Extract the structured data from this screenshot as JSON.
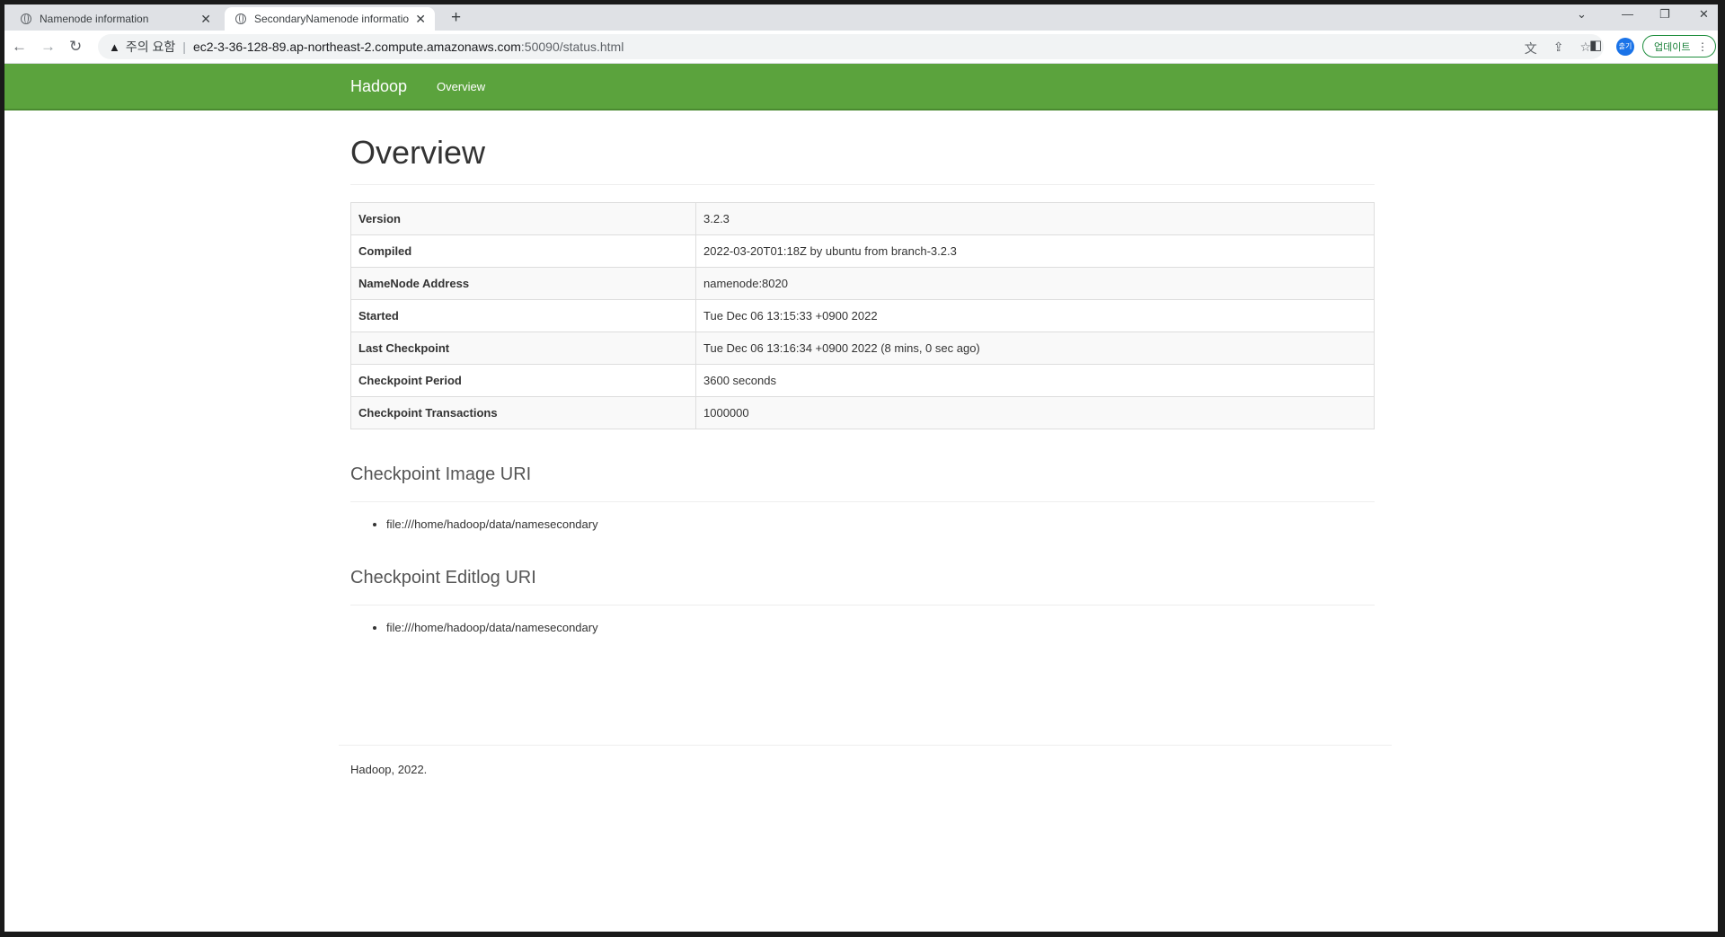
{
  "browser": {
    "tabs": [
      {
        "title": "Namenode information",
        "active": false
      },
      {
        "title": "SecondaryNamenode informatio",
        "active": true
      }
    ],
    "security_warning": "주의 요함",
    "url_host": "ec2-3-36-128-89.ap-northeast-2.compute.amazonaws.com",
    "url_path": ":50090/status.html",
    "profile_label": "출기",
    "update_label": "업데이트"
  },
  "navbar": {
    "brand": "Hadoop",
    "link": "Overview"
  },
  "page": {
    "title": "Overview",
    "info": [
      {
        "key": "Version",
        "value": "3.2.3"
      },
      {
        "key": "Compiled",
        "value": "2022-03-20T01:18Z by ubuntu from branch-3.2.3"
      },
      {
        "key": "NameNode Address",
        "value": "namenode:8020"
      },
      {
        "key": "Started",
        "value": "Tue Dec 06 13:15:33 +0900 2022"
      },
      {
        "key": "Last Checkpoint",
        "value": "Tue Dec 06 13:16:34 +0900 2022 (8 mins, 0 sec ago)"
      },
      {
        "key": "Checkpoint Period",
        "value": "3600 seconds"
      },
      {
        "key": "Checkpoint Transactions",
        "value": "1000000"
      }
    ],
    "image_uri_heading": "Checkpoint Image URI",
    "image_uris": [
      "file:///home/hadoop/data/namesecondary"
    ],
    "editlog_uri_heading": "Checkpoint Editlog URI",
    "editlog_uris": [
      "file:///home/hadoop/data/namesecondary"
    ],
    "footer": "Hadoop, 2022."
  }
}
